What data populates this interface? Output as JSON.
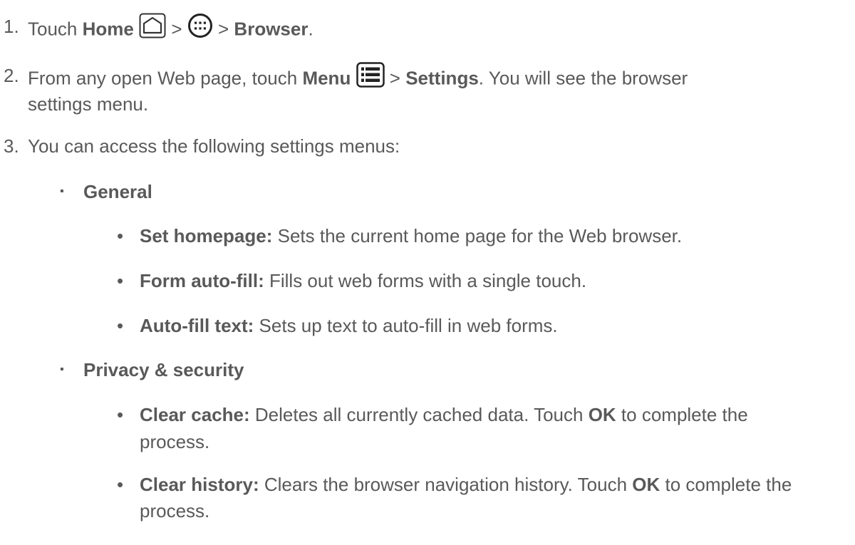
{
  "steps": [
    {
      "number": "1.",
      "touch_word": "Touch",
      "home_label": "Home",
      "sep1": ">",
      "sep2": ">",
      "browser_label": "Browser",
      "end": "."
    },
    {
      "number": "2.",
      "prefix": "From any open Web page, touch",
      "menu_label": "Menu",
      "sep": ">",
      "settings_label": "Settings",
      "suffix": ". You will see the browser",
      "continuation": "settings menu."
    },
    {
      "number": "3.",
      "text": "You can access the following settings menus:"
    }
  ],
  "bullets": [
    {
      "marker": "▪",
      "label": "General",
      "items": [
        {
          "marker": "•",
          "label": "Set homepage:",
          "text": "Sets the current home page for the Web browser."
        },
        {
          "marker": "•",
          "label": "Form auto-fill:",
          "text": "Fills out web forms with a single touch."
        },
        {
          "marker": "•",
          "label": "Auto-fill text:",
          "text": "Sets up text to auto-fill in web forms."
        }
      ]
    },
    {
      "marker": "▪",
      "label": "Privacy & security",
      "items": [
        {
          "marker": "•",
          "label": "Clear cache:",
          "text": "Deletes all currently cached data. Touch",
          "ok": "OK",
          "after": "to complete the",
          "continuation": "process."
        },
        {
          "marker": "•",
          "label": "Clear history:",
          "text": "Clears the browser navigation history. Touch",
          "ok": "OK",
          "after": "to complete the",
          "continuation": "process."
        }
      ]
    }
  ],
  "icons": {
    "home": "home-outline-icon",
    "apps": "all-apps-icon",
    "menu": "menu-list-icon"
  }
}
